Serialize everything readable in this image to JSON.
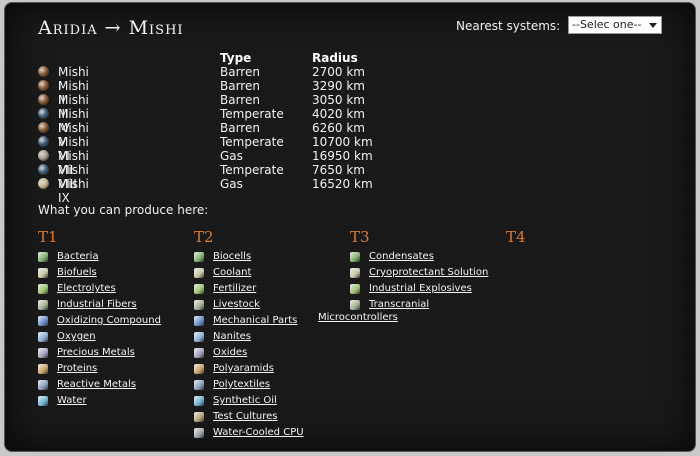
{
  "header": {
    "title": "Aridia → Mishi",
    "nearest_label": "Nearest systems:",
    "select_value": "--Selec one--"
  },
  "table": {
    "headers": {
      "type": "Type",
      "radius": "Radius"
    },
    "rows": [
      {
        "name": "Mishi I",
        "type": "Barren",
        "radius": "2700 km",
        "globe_color": "#8a5a33"
      },
      {
        "name": "Mishi II",
        "type": "Barren",
        "radius": "3290 km",
        "globe_color": "#8a5a33"
      },
      {
        "name": "Mishi III",
        "type": "Barren",
        "radius": "3050 km",
        "globe_color": "#8a5a33"
      },
      {
        "name": "Mishi IV",
        "type": "Temperate",
        "radius": "4020 km",
        "globe_color": "#3a5b78"
      },
      {
        "name": "Mishi V",
        "type": "Barren",
        "radius": "6260 km",
        "globe_color": "#8a5a33"
      },
      {
        "name": "Mishi VI",
        "type": "Temperate",
        "radius": "10700 km",
        "globe_color": "#3a5b78"
      },
      {
        "name": "Mishi VII",
        "type": "Gas",
        "radius": "16950 km",
        "globe_color": "#a8a290"
      },
      {
        "name": "Mishi VIII",
        "type": "Temperate",
        "radius": "7650 km",
        "globe_color": "#3a5b78"
      },
      {
        "name": "Mishi IX",
        "type": "Gas",
        "radius": "16520 km",
        "globe_color": "#c9b98e"
      }
    ]
  },
  "produce": {
    "label": "What you can produce here:",
    "tiers": [
      "T1",
      "T2",
      "T3",
      "T4"
    ],
    "t1": [
      "Bacteria",
      "Biofuels",
      "Electrolytes",
      "Industrial Fibers",
      "Oxidizing Compound",
      "Oxygen",
      "Precious Metals",
      "Proteins",
      "Reactive Metals",
      "Water"
    ],
    "t2": [
      "Biocells",
      "Coolant",
      "Fertilizer",
      "Livestock",
      "Mechanical Parts",
      "Nanites",
      "Oxides",
      "Polyaramids",
      "Polytextiles",
      "Synthetic Oil",
      "Test Cultures",
      "Water-Cooled CPU"
    ],
    "t3": [
      "Condensates",
      "Cryoprotectant Solution",
      "Industrial Explosives",
      "Transcranial"
    ],
    "t3_wrap": "Microcontrollers"
  },
  "colors": {
    "tier_accent": "#e07a2c",
    "panel_bg": "#1a1a1a",
    "text": "#f2f2f2"
  }
}
